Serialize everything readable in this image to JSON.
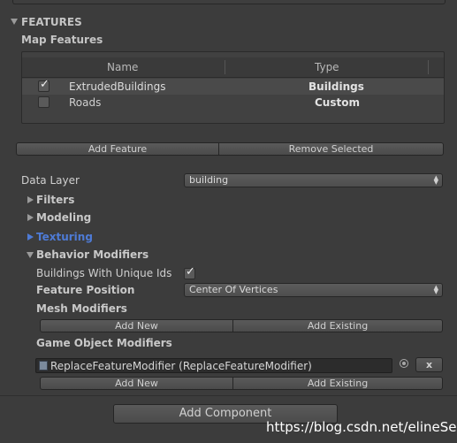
{
  "section": {
    "title": "FEATURES"
  },
  "map_features": {
    "label": "Map Features",
    "columns": [
      "Name",
      "Type"
    ],
    "rows": [
      {
        "checked": true,
        "name": "ExtrudedBuildings",
        "type": "Buildings",
        "selected": true
      },
      {
        "checked": false,
        "name": "Roads",
        "type": "Custom",
        "selected": false
      }
    ],
    "add_button": "Add Feature",
    "remove_button": "Remove Selected"
  },
  "data_layer": {
    "label": "Data Layer",
    "value": "building"
  },
  "foldouts": {
    "filters": "Filters",
    "modeling": "Modeling",
    "texturing": "Texturing",
    "behavior": "Behavior Modifiers"
  },
  "behavior": {
    "unique_ids_label": "Buildings With Unique Ids",
    "unique_ids_checked": true,
    "feature_position_label": "Feature Position",
    "feature_position_value": "Center Of Vertices",
    "mesh_modifiers_label": "Mesh Modifiers",
    "game_object_modifiers_label": "Game Object Modifiers",
    "add_new": "Add New",
    "add_existing": "Add Existing",
    "go_modifier_value": "ReplaceFeatureModifier (ReplaceFeatureModifier)",
    "remove_x": "x"
  },
  "add_component": "Add Component",
  "watermark": "https://blog.csdn.net/elineSea",
  "colors": {
    "background": "#3c3c3c",
    "texturing_accent": "#4e7bd6",
    "text": "#c8c8c8"
  }
}
